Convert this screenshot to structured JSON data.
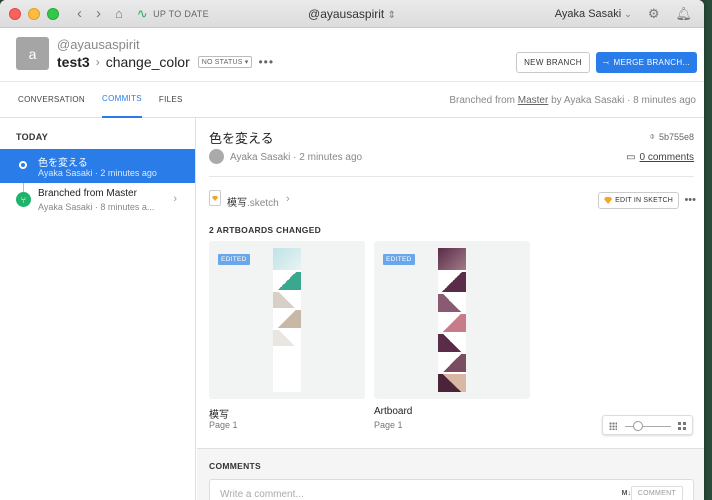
{
  "titlebar": {
    "sync_status": "UP TO DATE",
    "workspace": "@ayausaspirit",
    "user": "Ayaka Sasaki"
  },
  "header": {
    "avatar_letter": "a",
    "owner": "@ayausaspirit",
    "project": "test3",
    "branch": "change_color",
    "status": "NO STATUS ▾",
    "new_branch": "NEW BRANCH",
    "merge_branch": "MERGE BRANCH..."
  },
  "tabs": [
    {
      "label": "CONVERSATION",
      "active": false
    },
    {
      "label": "COMMITS",
      "active": true
    },
    {
      "label": "FILES",
      "active": false
    }
  ],
  "branched_info": {
    "prefix": "Branched from",
    "source": "Master",
    "suffix": "by Ayaka Sasaki · 8 minutes ago"
  },
  "sidebar": {
    "section": "TODAY",
    "commits": [
      {
        "title": "色を変える",
        "sub": "Ayaka Sasaki · 2 minutes ago",
        "selected": true
      },
      {
        "title": "Branched from Master",
        "sub": "Ayaka Sasaki · 8 minutes a...",
        "selected": false
      }
    ]
  },
  "commit": {
    "title": "色を変える",
    "hash": "5b755e8",
    "author_line": "Ayaka Sasaki · 2 minutes ago",
    "comments_link": "0 comments",
    "file_base": "模写",
    "file_ext": ".sketch",
    "edit_in_sketch": "EDIT IN SKETCH",
    "artboards_changed": "2 ARTBOARDS CHANGED",
    "artboards": [
      {
        "badge": "EDITED",
        "name": "模写",
        "page": "Page 1"
      },
      {
        "badge": "EDITED",
        "name": "Artboard",
        "page": "Page 1"
      }
    ]
  },
  "comments": {
    "header": "COMMENTS",
    "placeholder": "Write a comment...",
    "markdown": "M↓",
    "button": "COMMENT"
  },
  "colors": {
    "accent": "#2a7ce8",
    "success": "#1fb26b",
    "sketch": "#f5a623"
  }
}
